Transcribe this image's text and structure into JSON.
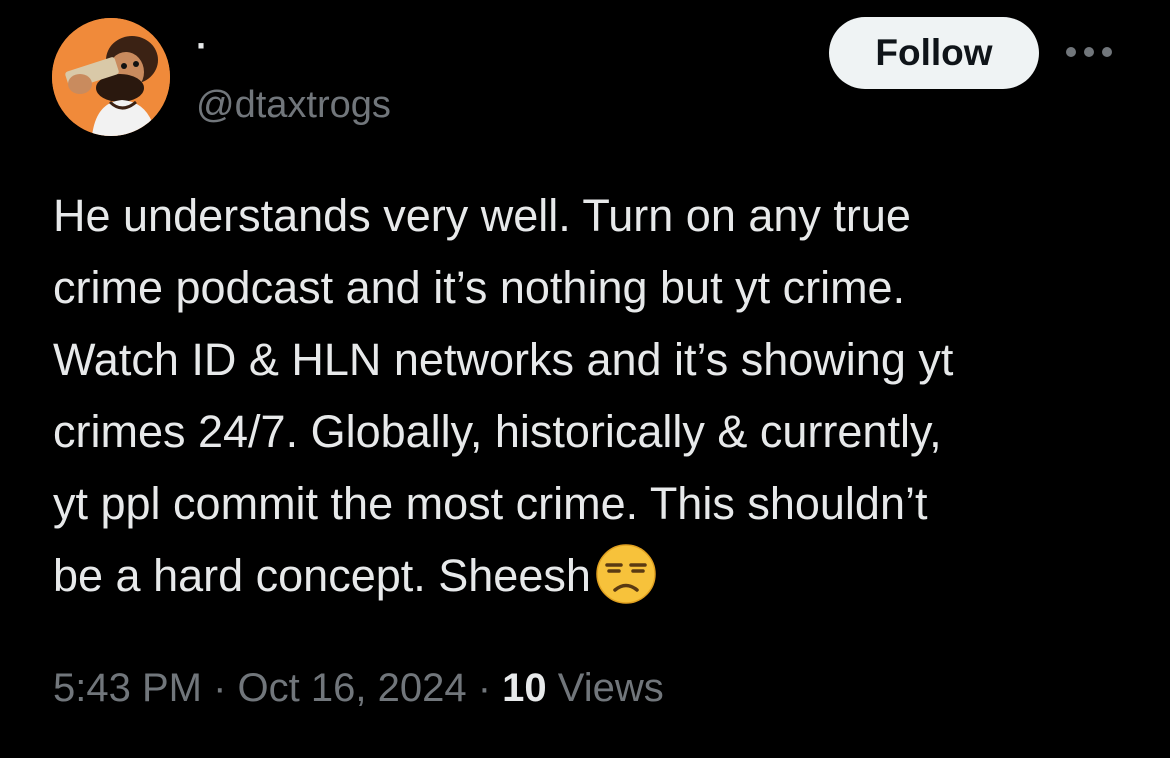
{
  "author": {
    "display_name": "·",
    "handle": "@dtaxtrogs",
    "avatar_icon": "cartoon-avatar-icon"
  },
  "header": {
    "follow_label": "Follow",
    "more_icon": "more-options-icon"
  },
  "tweet": {
    "text": "He understands very well. Turn on any true\ncrime podcast and it’s nothing but yt crime.\nWatch ID & HLN networks and it’s showing yt\ncrimes 24/7. Globally, historically & currently,\nyt ppl commit the most crime. This shouldn’t\nbe a hard concept. Sheesh",
    "emoji": "unamused-face-emoji"
  },
  "meta": {
    "time": "5:43 PM",
    "separator": "·",
    "date": "Oct 16, 2024",
    "views_count": "10",
    "views_label": "Views"
  },
  "colors": {
    "background": "#000000",
    "primary_text": "#e7e9ea",
    "secondary_text": "#71767b",
    "follow_bg": "#eff3f4",
    "follow_text": "#0f1419"
  }
}
